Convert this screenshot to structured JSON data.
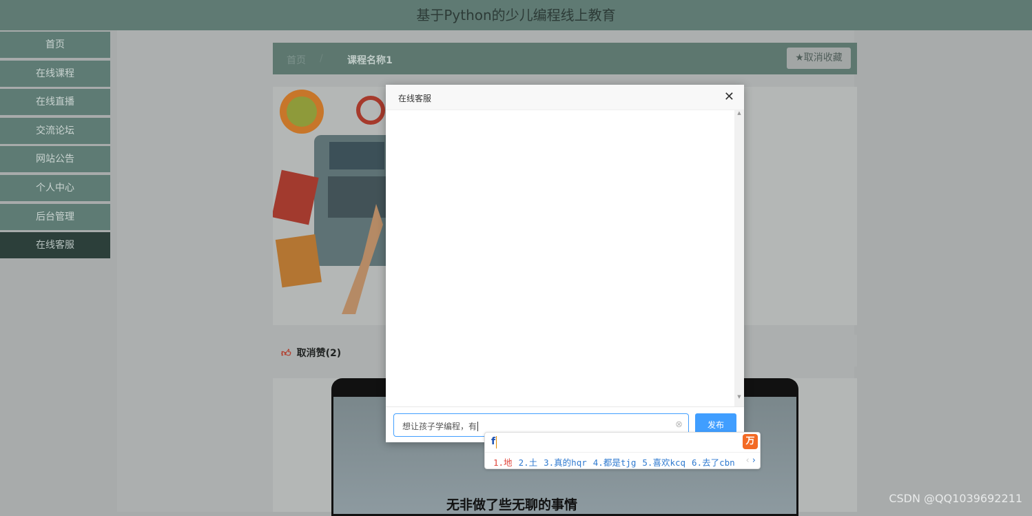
{
  "header": {
    "title": "基于Python的少儿编程线上教育"
  },
  "sidebar": {
    "items": [
      {
        "label": "首页"
      },
      {
        "label": "在线课程"
      },
      {
        "label": "在线直播"
      },
      {
        "label": "交流论坛"
      },
      {
        "label": "网站公告"
      },
      {
        "label": "个人中心"
      },
      {
        "label": "后台管理"
      },
      {
        "label": "在线客服",
        "active": true
      }
    ]
  },
  "breadcrumb": {
    "home": "首页",
    "separator": "/",
    "current": "课程名称1"
  },
  "favorite": {
    "label": "取消收藏",
    "icon": "star-icon"
  },
  "like": {
    "label": "取消赞(2)",
    "icon": "thumbs-up-icon"
  },
  "video": {
    "caption": "无非做了些无聊的事情"
  },
  "modal": {
    "title": "在线客服",
    "input_value": "想让孩子学编程，有",
    "send_label": "发布"
  },
  "ime": {
    "composition": "f",
    "candidates": [
      "1.地",
      "2.土",
      "3.真的hqr",
      "4.都是tjg",
      "5.喜欢kcq",
      "6.去了cbn"
    ]
  },
  "watermark": "CSDN @QQ1039692211",
  "colors": {
    "header": "#5f7a73",
    "sidebar": "#5e7b74",
    "sidebar_active": "#2c3f3a",
    "primary": "#409eff"
  }
}
